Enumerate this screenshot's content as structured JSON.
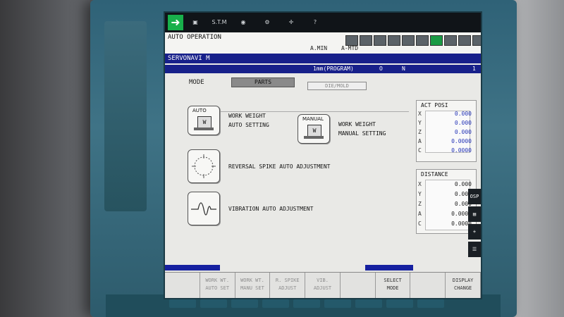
{
  "iconbar": {
    "run_icon": "arrow-right-icon",
    "items": [
      {
        "label": "",
        "icon": "machine-icon"
      },
      {
        "label": "S.T.M",
        "icon": "stm-icon"
      },
      {
        "label": "",
        "icon": "camera-icon"
      },
      {
        "label": "",
        "icon": "gear-icon"
      },
      {
        "label": "",
        "icon": "tool-icon"
      },
      {
        "label": "?",
        "icon": "help-icon"
      }
    ]
  },
  "header": {
    "operation": "AUTO OPERATION",
    "a_min": "A.MIN",
    "a_mtd": "A-MTD"
  },
  "title": "SERVONAVI M",
  "program": {
    "text": "1mm(PROGRAM)",
    "o_label": "O",
    "n_label": "N",
    "n_value": "1"
  },
  "mode": {
    "label": "MODE",
    "selected": "PARTS",
    "other": "DIE/MOLD"
  },
  "features": [
    {
      "tag": "AUTO",
      "weight": "W",
      "line1": "WORK WEIGHT",
      "line2": "AUTO SETTING"
    },
    {
      "tag": "MANUAL",
      "weight": "W",
      "line1": "WORK WEIGHT",
      "line2": "MANUAL SETTING"
    },
    {
      "line1": "REVERSAL SPIKE AUTO ADJUSTMENT"
    },
    {
      "line1": "VIBRATION AUTO ADJUSTMENT"
    }
  ],
  "act_posi": {
    "title": "ACT POSI",
    "rows": [
      {
        "axis": "X",
        "value": "0.000"
      },
      {
        "axis": "Y",
        "value": "0.000"
      },
      {
        "axis": "Z",
        "value": "0.000"
      },
      {
        "axis": "A",
        "value": "0.0000"
      },
      {
        "axis": "C",
        "value": "0.0000"
      }
    ]
  },
  "distance": {
    "title": "DISTANCE",
    "rows": [
      {
        "axis": "X",
        "value": "0.000"
      },
      {
        "axis": "Y",
        "value": "0.000"
      },
      {
        "axis": "Z",
        "value": "0.000"
      },
      {
        "axis": "A",
        "value": "0.0000"
      },
      {
        "axis": "C",
        "value": "0.0000"
      }
    ]
  },
  "softkeys": [
    {
      "label": "",
      "faded": true
    },
    {
      "label": "WORK WT.\nAUTO SET",
      "faded": true
    },
    {
      "label": "WORK WT.\nMANU SET",
      "faded": true
    },
    {
      "label": "R. SPIKE\nADJUST",
      "faded": true
    },
    {
      "label": "VIB.\nADJUST",
      "faded": true
    },
    {
      "label": "",
      "faded": true
    },
    {
      "label": "SELECT\nMODE",
      "faded": false
    },
    {
      "label": "",
      "faded": true
    },
    {
      "label": "DISPLAY\nCHANGE",
      "faded": false
    }
  ],
  "side_buttons": [
    "OSP",
    "",
    "+",
    ""
  ],
  "colors": {
    "title_bar": "#17208a",
    "value_text": "#2636b8",
    "run_icon": "#18b04b",
    "bezel": "#2f6277"
  }
}
